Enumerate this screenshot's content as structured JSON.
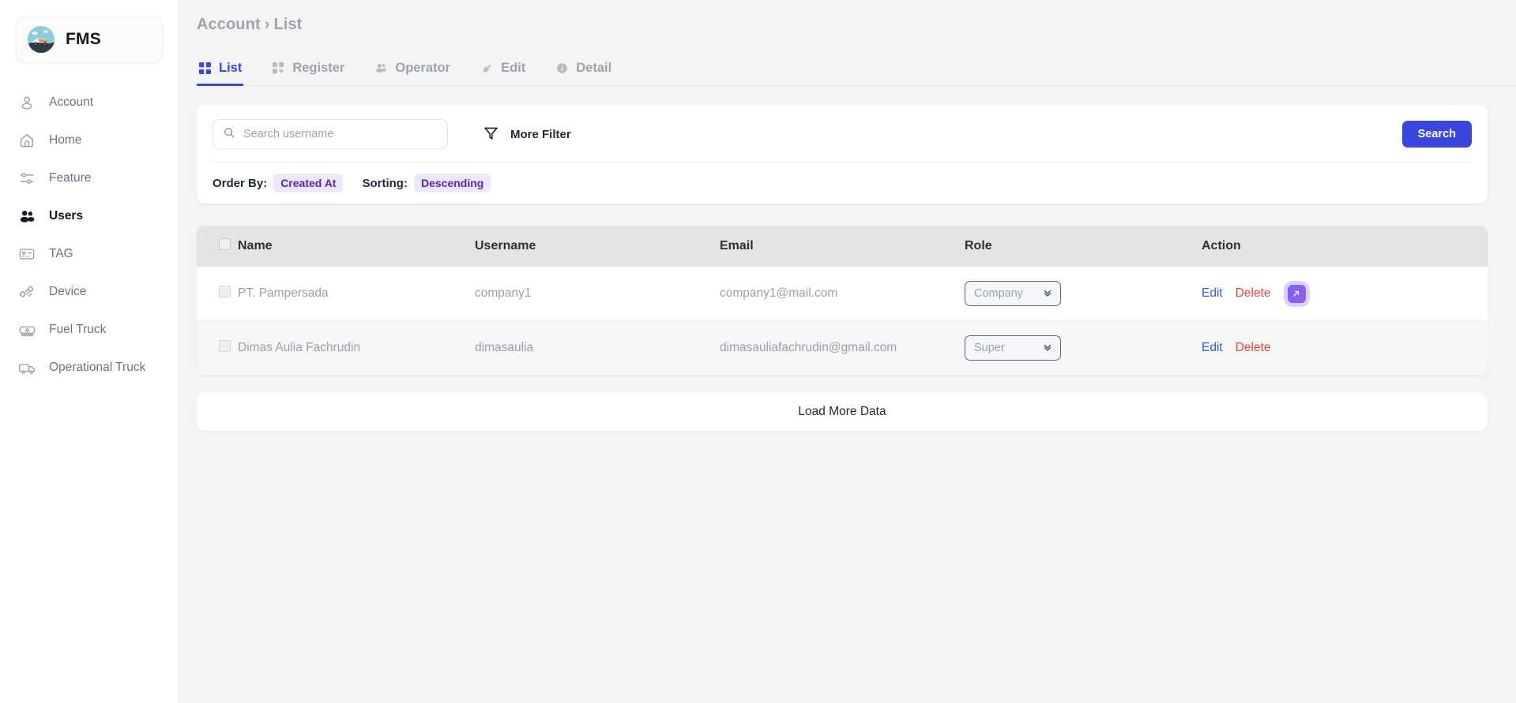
{
  "brand": {
    "name": "FMS",
    "logo_icon": "truck-landscape-logo"
  },
  "sidebar": {
    "items": [
      {
        "label": "Account",
        "icon": "user-icon",
        "active": false
      },
      {
        "label": "Home",
        "icon": "home-icon",
        "active": false
      },
      {
        "label": "Feature",
        "icon": "sliders-icon",
        "active": false
      },
      {
        "label": "Users",
        "icon": "users-group-icon",
        "active": true
      },
      {
        "label": "TAG",
        "icon": "id-card-icon",
        "active": false
      },
      {
        "label": "Device",
        "icon": "satellite-icon",
        "active": false
      },
      {
        "label": "Fuel Truck",
        "icon": "fuel-truck-icon",
        "active": false
      },
      {
        "label": "Operational Truck",
        "icon": "delivery-truck-icon",
        "active": false
      }
    ]
  },
  "breadcrumb": {
    "root": "Account",
    "separator": "›",
    "current": "List"
  },
  "tabs": [
    {
      "label": "List",
      "icon": "grid-icon",
      "active": true
    },
    {
      "label": "Register",
      "icon": "grid-plus-icon",
      "active": false
    },
    {
      "label": "Operator",
      "icon": "user-group-icon",
      "active": false
    },
    {
      "label": "Edit",
      "icon": "pencil-icon",
      "active": false
    },
    {
      "label": "Detail",
      "icon": "info-icon",
      "active": false
    }
  ],
  "filter": {
    "search_placeholder": "Search username",
    "search_value": "",
    "search_icon": "magnifier-icon",
    "more_filter_label": "More Filter",
    "more_filter_icon": "funnel-icon",
    "search_button_label": "Search",
    "order_by_label": "Order By:",
    "order_by_value": "Created At",
    "sorting_label": "Sorting:",
    "sorting_value": "Descending"
  },
  "table": {
    "columns": [
      "Name",
      "Username",
      "Email",
      "Role",
      "Action"
    ],
    "rows": [
      {
        "name": "PT. Pampersada",
        "username": "company1",
        "email": "company1@mail.com",
        "role": "Company",
        "edit_label": "Edit",
        "delete_label": "Delete",
        "has_open_action": true
      },
      {
        "name": "Dimas Aulia Fachrudin",
        "username": "dimasaulia",
        "email": "dimasauliafachrudin@gmail.com",
        "role": "Super",
        "edit_label": "Edit",
        "delete_label": "Delete",
        "has_open_action": false
      }
    ]
  },
  "load_more": {
    "label": "Load More Data"
  },
  "colors": {
    "accent": "#3b46e0",
    "pill_bg": "#ece9fd",
    "pill_text": "#5b21b6",
    "delete": "#e8453c",
    "edit": "#2f5fe0",
    "open_action": "#8b5cf6",
    "table_header_bg": "#e5e4e3",
    "page_bg": "#f4f4f5"
  }
}
